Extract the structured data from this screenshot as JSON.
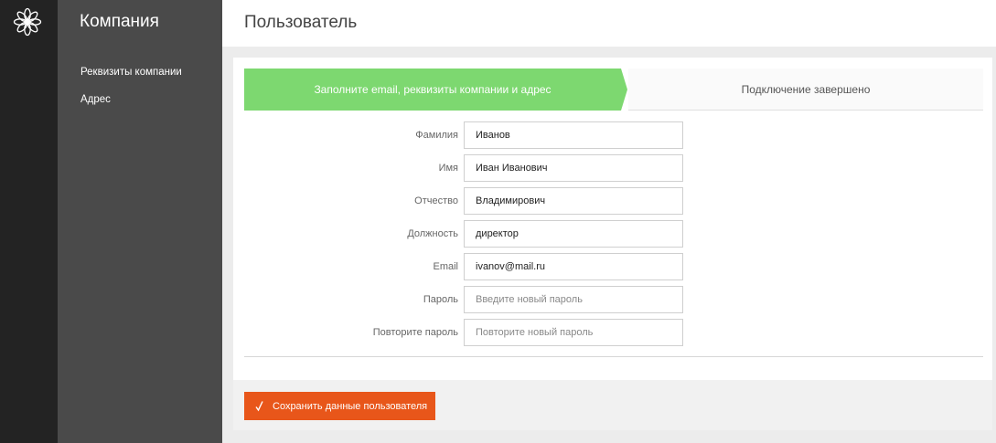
{
  "sidebar": {
    "title": "Компания",
    "items": [
      {
        "label": "Реквизиты компании"
      },
      {
        "label": "Адрес"
      }
    ]
  },
  "header": {
    "title": "Пользователь"
  },
  "steps": [
    {
      "label": "Заполните email, реквизиты компании и адрес",
      "state": "active"
    },
    {
      "label": "Подключение завершено",
      "state": "pending"
    }
  ],
  "form": {
    "fields": [
      {
        "label": "Фамилия",
        "value": "Иванов",
        "placeholder": ""
      },
      {
        "label": "Имя",
        "value": "Иван Иванович",
        "placeholder": ""
      },
      {
        "label": "Отчество",
        "value": "Владимирович",
        "placeholder": ""
      },
      {
        "label": "Должность",
        "value": "директор",
        "placeholder": ""
      },
      {
        "label": "Email",
        "value": "ivanov@mail.ru",
        "placeholder": ""
      },
      {
        "label": "Пароль",
        "value": "",
        "placeholder": "Введите новый пароль"
      },
      {
        "label": "Повторите пароль",
        "value": "",
        "placeholder": "Повторите новый пароль"
      }
    ]
  },
  "actions": {
    "save_label": "Сохранить данные пользователя"
  },
  "colors": {
    "rail": "#232323",
    "sidebar": "#4a4a4a",
    "step_active": "#7dd870",
    "save_button": "#e8561a"
  },
  "icons": {
    "logo": "flower-logo-icon",
    "save": "check-icon"
  }
}
